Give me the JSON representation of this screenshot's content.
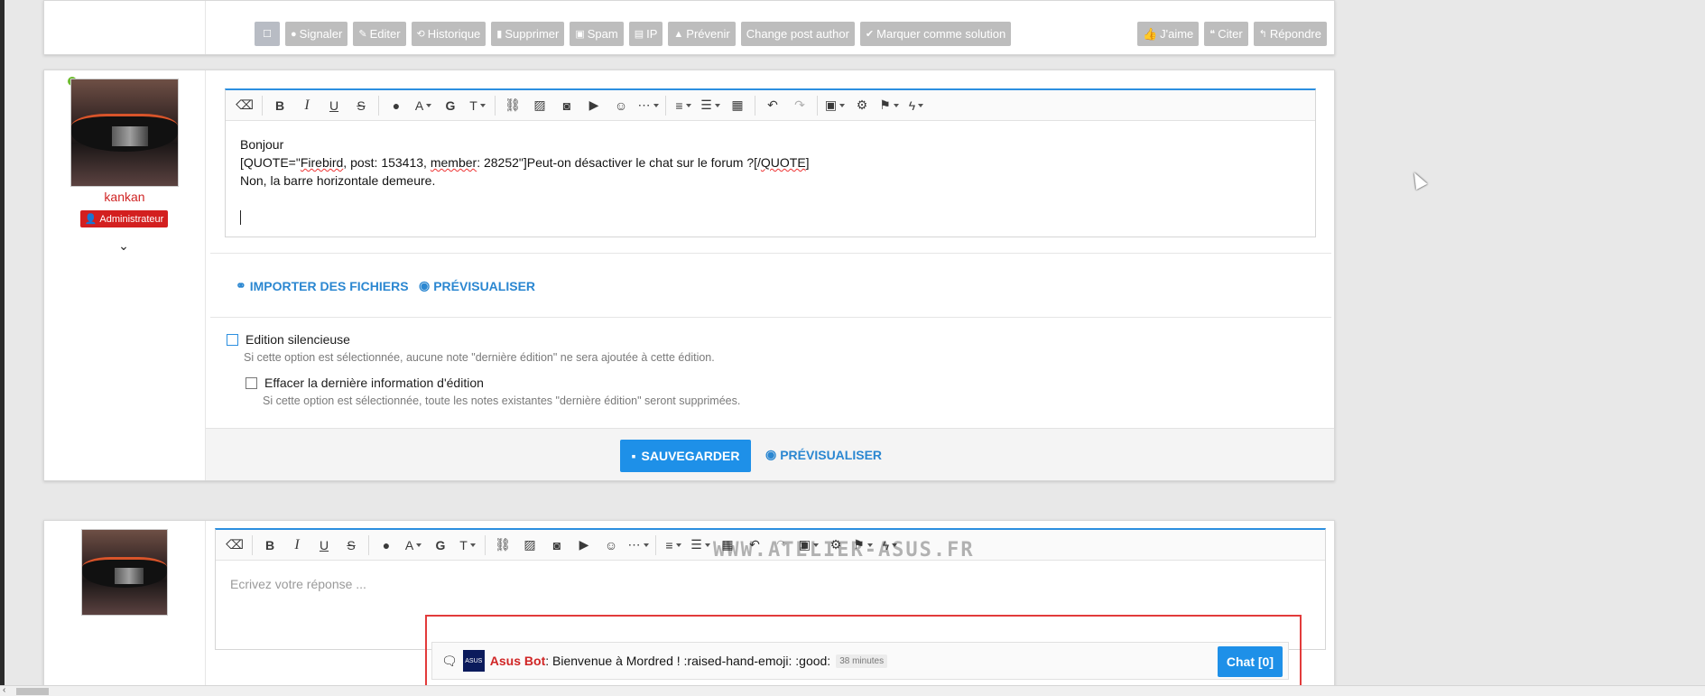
{
  "post_actions": {
    "left": [
      {
        "name": "select-button",
        "icon": "square-icon",
        "label": ""
      },
      {
        "name": "report-button",
        "icon": "exclamation-icon",
        "label": "Signaler"
      },
      {
        "name": "edit-button",
        "icon": "pencil-icon",
        "label": "Editer"
      },
      {
        "name": "history-button",
        "icon": "history-icon",
        "label": "Historique"
      },
      {
        "name": "delete-button",
        "icon": "trash-icon",
        "label": "Supprimer"
      },
      {
        "name": "spam-button",
        "icon": "spam-icon",
        "label": "Spam"
      },
      {
        "name": "ip-button",
        "icon": "id-card-icon",
        "label": "IP"
      },
      {
        "name": "warn-button",
        "icon": "warning-icon",
        "label": "Prévenir"
      },
      {
        "name": "change-author-button",
        "icon": "",
        "label": "Change post author"
      },
      {
        "name": "mark-solution-button",
        "icon": "check-icon",
        "label": "Marquer comme solution"
      }
    ],
    "right": [
      {
        "name": "like-button",
        "icon": "thumbs-up-icon",
        "label": "J'aime"
      },
      {
        "name": "quote-button",
        "icon": "quote-icon",
        "label": "Citer"
      },
      {
        "name": "reply-button",
        "icon": "reply-icon",
        "label": "Répondre"
      }
    ]
  },
  "author": {
    "username": "kankan",
    "role": "Administrateur"
  },
  "editor": {
    "lines": [
      "Bonjour",
      "Non, la barre horizontale demeure."
    ],
    "quote_line": {
      "open_tag": "[QUOTE=\"",
      "author": "Firebird",
      "mid1": ", post: 153413, ",
      "member_word": "member",
      "mid2": ": 28252\"]Peut-on désactiver le chat sur le forum ?[/",
      "close_word": "QUOTE",
      "end": "]"
    }
  },
  "links": {
    "import_files": "IMPORTER DES FICHIERS",
    "preview": "PRÉVISUALISER"
  },
  "options": {
    "silent_edit": {
      "label": "Edition silencieuse",
      "hint": "Si cette option est sélectionnée, aucune note \"dernière édition\" ne sera ajoutée à cette édition."
    },
    "clear_last_edit": {
      "label": "Effacer la dernière information d'édition",
      "hint": "Si cette option est sélectionnée, toute les notes existantes \"dernière édition\" seront supprimées."
    }
  },
  "footer": {
    "save": "SAUVEGARDER",
    "preview": "PRÉVISUALISER"
  },
  "reply": {
    "placeholder": "Ecrivez votre réponse ..."
  },
  "watermark": "WWW.ATELIER-ASUS.FR",
  "chat": {
    "bot_name": "Asus Bot",
    "logo_text": "ASUS",
    "message": "Bienvenue à Mordred ! :raised-hand-emoji: :good:",
    "time": "38 minutes",
    "button": "Chat [0]"
  },
  "colors": {
    "accent": "#1e90e8",
    "admin": "#d31f1f",
    "frame": "#e23b3b"
  }
}
